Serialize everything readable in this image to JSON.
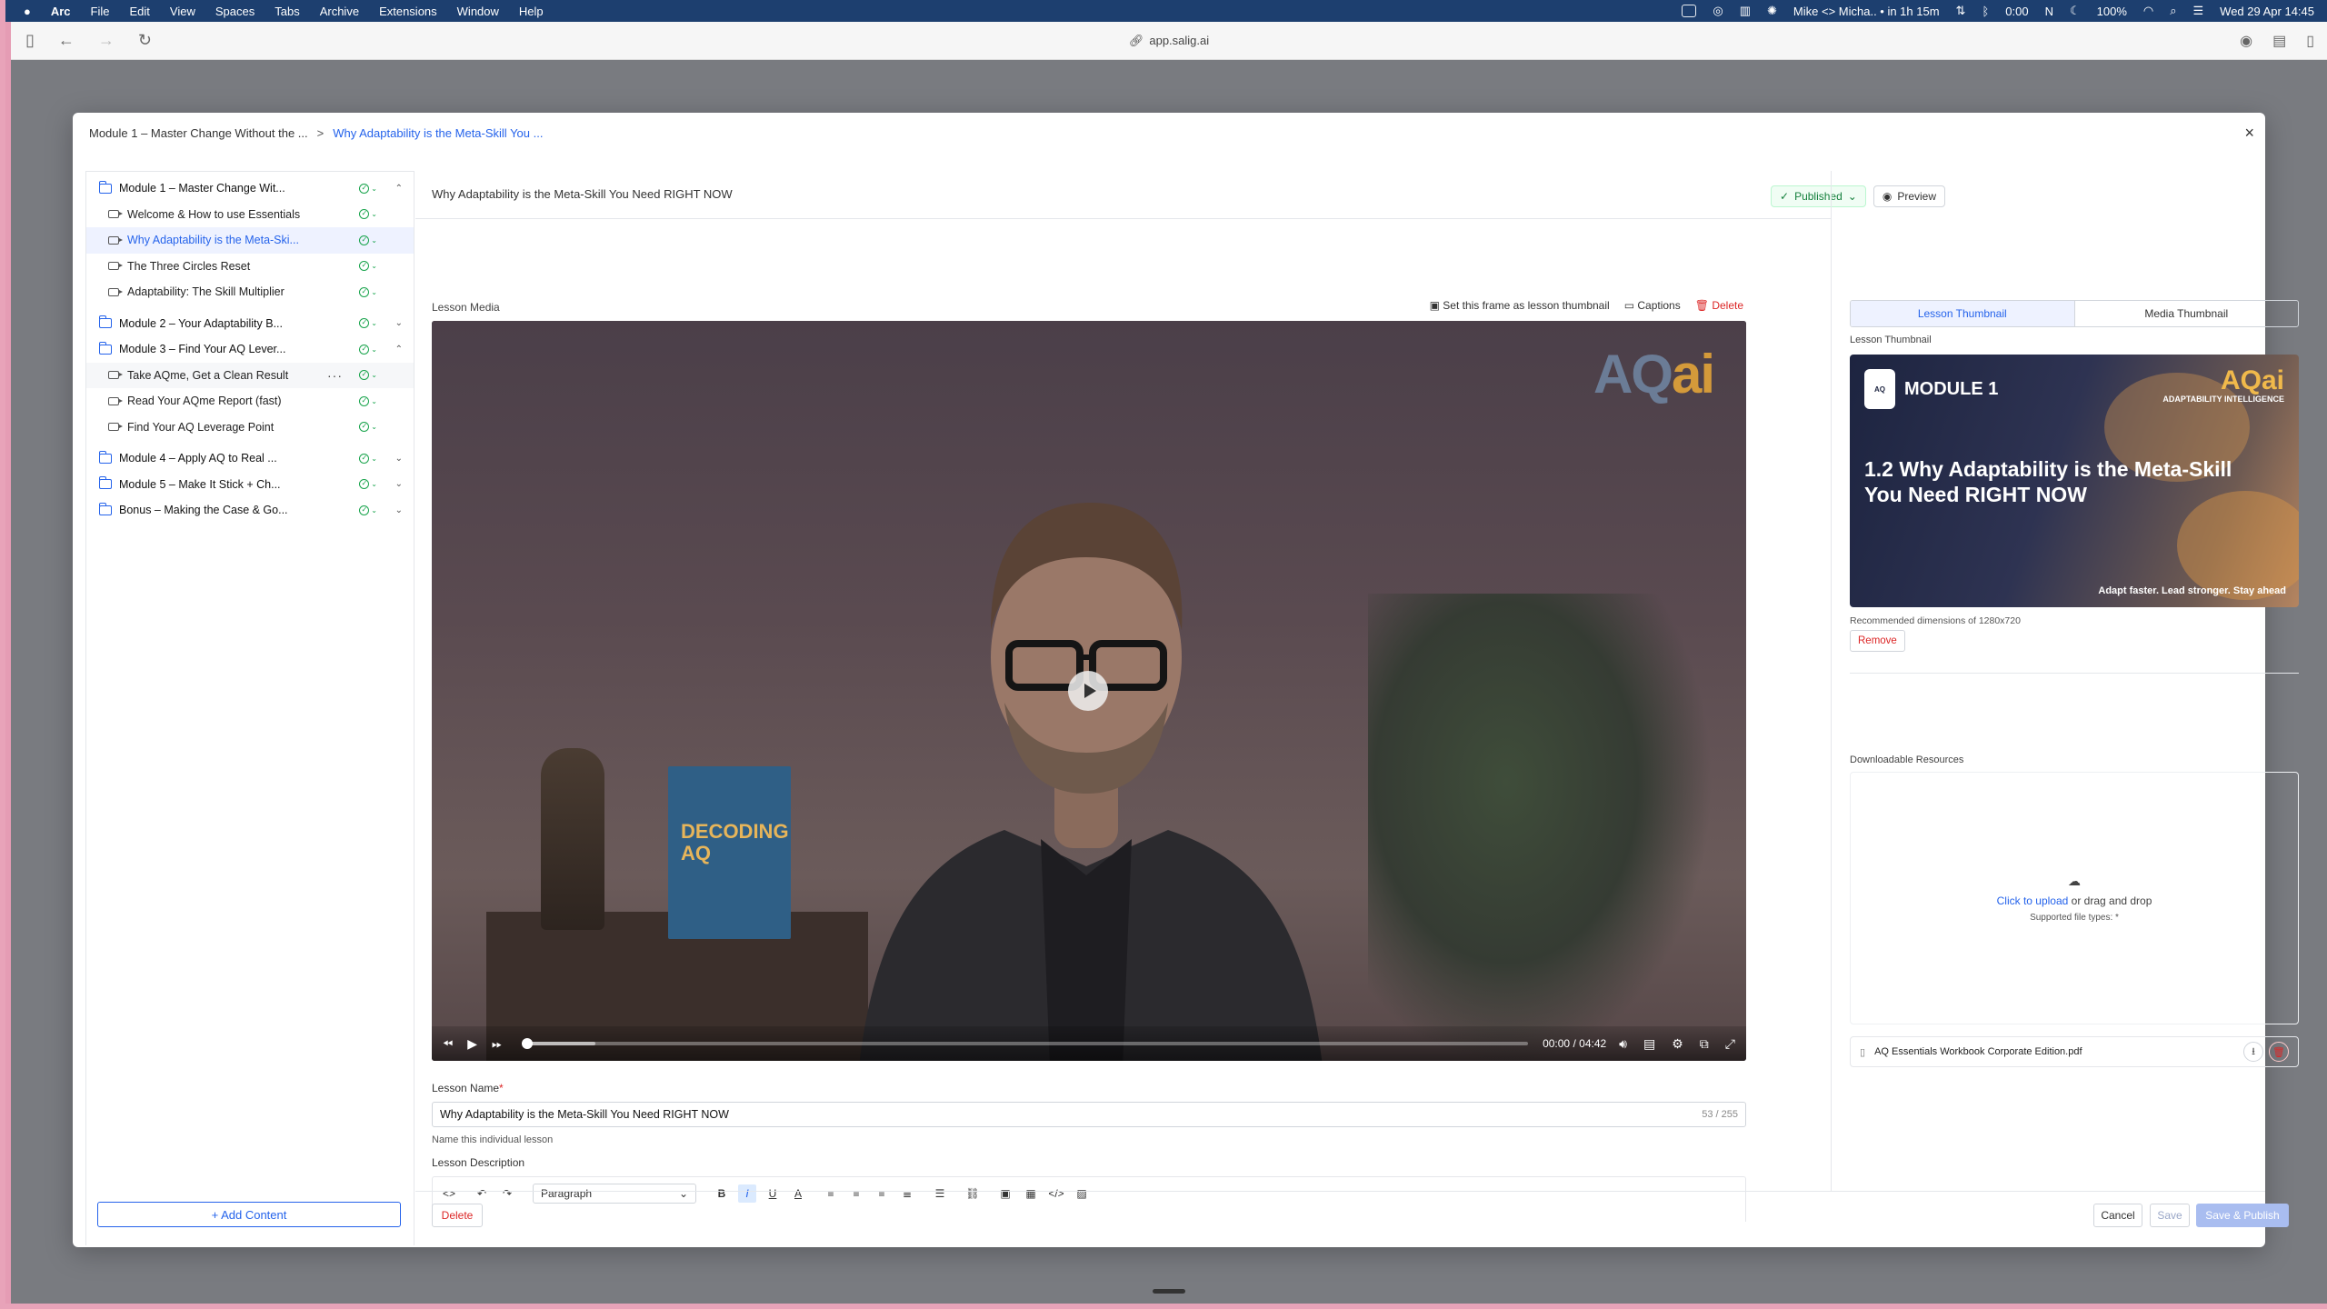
{
  "menubar": {
    "app": "Arc",
    "items": [
      "File",
      "Edit",
      "View",
      "Spaces",
      "Tabs",
      "Archive",
      "Extensions",
      "Window",
      "Help"
    ],
    "meeting": "Mike <> Micha.. • in 1h 15m",
    "timer": "0:00",
    "battery": "100%",
    "datetime": "Wed 29 Apr  14:45"
  },
  "browser": {
    "url": "app.salig.ai"
  },
  "modal": {
    "breadcrumb_parent": "Module 1 – Master Change Without the ...",
    "breadcrumb_sep": ">",
    "breadcrumb_current": "Why Adaptability is the Meta-Skill You ...",
    "close": "×"
  },
  "sidebar": {
    "items": [
      {
        "type": "module",
        "label": "Module 1 – Master Change Wit...",
        "expand": "⌃"
      },
      {
        "type": "lesson",
        "label": "Welcome & How to use Essentials"
      },
      {
        "type": "lesson",
        "label": "Why Adaptability is the Meta-Ski...",
        "selected": true
      },
      {
        "type": "lesson",
        "label": "The Three Circles Reset"
      },
      {
        "type": "lesson",
        "label": "Adaptability: The Skill Multiplier"
      },
      {
        "type": "module",
        "label": "Module 2 – Your Adaptability B...",
        "expand": "⌄"
      },
      {
        "type": "module",
        "label": "Module 3 – Find Your AQ Lever...",
        "expand": "⌃"
      },
      {
        "type": "lesson",
        "label": "Take AQme, Get a Clean Result",
        "hover": true
      },
      {
        "type": "lesson",
        "label": "Read Your AQme Report (fast)"
      },
      {
        "type": "lesson",
        "label": "Find Your AQ Leverage Point"
      },
      {
        "type": "module",
        "label": "Module 4 – Apply AQ to Real ...",
        "expand": "⌄"
      },
      {
        "type": "module",
        "label": "Module 5 – Make It Stick + Ch...",
        "expand": "⌄"
      },
      {
        "type": "module",
        "label": "Bonus – Making the Case & Go...",
        "expand": "⌄"
      }
    ],
    "add_content": "+ Add Content"
  },
  "main": {
    "lesson_title": "Why Adaptability is the Meta-Skill You Need RIGHT NOW",
    "status": "Published",
    "preview": "Preview",
    "media_label": "Lesson Media",
    "set_thumb": "Set this frame as lesson thumbnail",
    "captions": "Captions",
    "delete_media": "Delete",
    "video": {
      "watermark_a": "AQ",
      "watermark_b": "ai",
      "book_text": "DECODING AQ",
      "current_time": "00:00",
      "time_sep": "/",
      "duration": "04:42"
    },
    "name_label": "Lesson Name",
    "name_req": "*",
    "name_value": "Why Adaptability is the Meta-Skill You Need RIGHT NOW",
    "name_count": "53 / 255",
    "name_hint": "Name this individual lesson",
    "desc_label": "Lesson Description",
    "paragraph": "Paragraph"
  },
  "right": {
    "tab_lesson": "Lesson Thumbnail",
    "tab_media": "Media Thumbnail",
    "thumb_label": "Lesson Thumbnail",
    "thumb_module": "MODULE 1",
    "thumb_badge": "AQ",
    "thumb_brand": "AQai",
    "thumb_brand_sub": "ADAPTABILITY INTELLIGENCE",
    "thumb_title": "1.2 Why Adaptability is the Meta-Skill You Need RIGHT NOW",
    "thumb_tagline": "Adapt faster. Lead stronger. Stay ahead",
    "recommended": "Recommended dimensions of 1280x720",
    "remove": "Remove",
    "resources_label": "Downloadable Resources",
    "upload_link": "Click to upload",
    "upload_rest": " or drag and drop",
    "supported": "Supported file types: *",
    "file_name": "AQ Essentials Workbook Corporate Edition.pdf"
  },
  "footer": {
    "delete": "Delete",
    "cancel": "Cancel",
    "save": "Save",
    "save_publish": "Save & Publish"
  },
  "colors": {
    "accent": "#2563eb",
    "success": "#16a34a",
    "danger": "#dc2626"
  }
}
